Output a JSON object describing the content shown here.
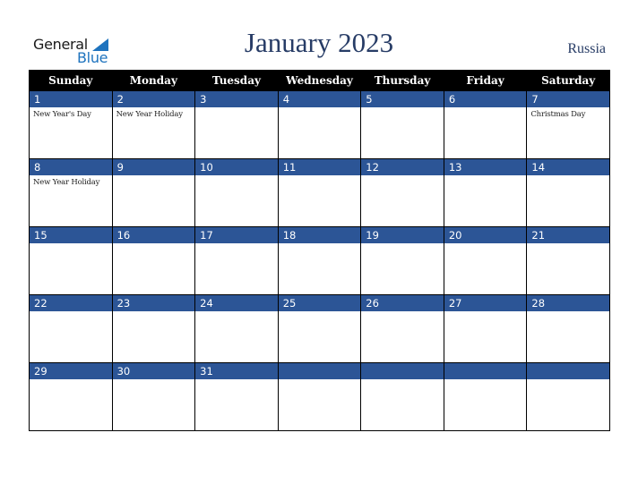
{
  "logo": {
    "line1": "General",
    "line2": "Blue",
    "icon": "triangle-flag-icon"
  },
  "header": {
    "title": "January 2023",
    "country": "Russia"
  },
  "colors": {
    "title": "#273c66",
    "daybar": "#2c5596",
    "header_bg": "#000000",
    "logo_blue": "#1e73be"
  },
  "weekdays": [
    "Sunday",
    "Monday",
    "Tuesday",
    "Wednesday",
    "Thursday",
    "Friday",
    "Saturday"
  ],
  "weeks": [
    [
      {
        "day": "1",
        "event": "New Year's Day"
      },
      {
        "day": "2",
        "event": "New Year Holiday"
      },
      {
        "day": "3",
        "event": ""
      },
      {
        "day": "4",
        "event": ""
      },
      {
        "day": "5",
        "event": ""
      },
      {
        "day": "6",
        "event": ""
      },
      {
        "day": "7",
        "event": "Christmas Day"
      }
    ],
    [
      {
        "day": "8",
        "event": "New Year Holiday"
      },
      {
        "day": "9",
        "event": ""
      },
      {
        "day": "10",
        "event": ""
      },
      {
        "day": "11",
        "event": ""
      },
      {
        "day": "12",
        "event": ""
      },
      {
        "day": "13",
        "event": ""
      },
      {
        "day": "14",
        "event": ""
      }
    ],
    [
      {
        "day": "15",
        "event": ""
      },
      {
        "day": "16",
        "event": ""
      },
      {
        "day": "17",
        "event": ""
      },
      {
        "day": "18",
        "event": ""
      },
      {
        "day": "19",
        "event": ""
      },
      {
        "day": "20",
        "event": ""
      },
      {
        "day": "21",
        "event": ""
      }
    ],
    [
      {
        "day": "22",
        "event": ""
      },
      {
        "day": "23",
        "event": ""
      },
      {
        "day": "24",
        "event": ""
      },
      {
        "day": "25",
        "event": ""
      },
      {
        "day": "26",
        "event": ""
      },
      {
        "day": "27",
        "event": ""
      },
      {
        "day": "28",
        "event": ""
      }
    ],
    [
      {
        "day": "29",
        "event": ""
      },
      {
        "day": "30",
        "event": ""
      },
      {
        "day": "31",
        "event": ""
      },
      {
        "day": "",
        "event": ""
      },
      {
        "day": "",
        "event": ""
      },
      {
        "day": "",
        "event": ""
      },
      {
        "day": "",
        "event": ""
      }
    ]
  ]
}
